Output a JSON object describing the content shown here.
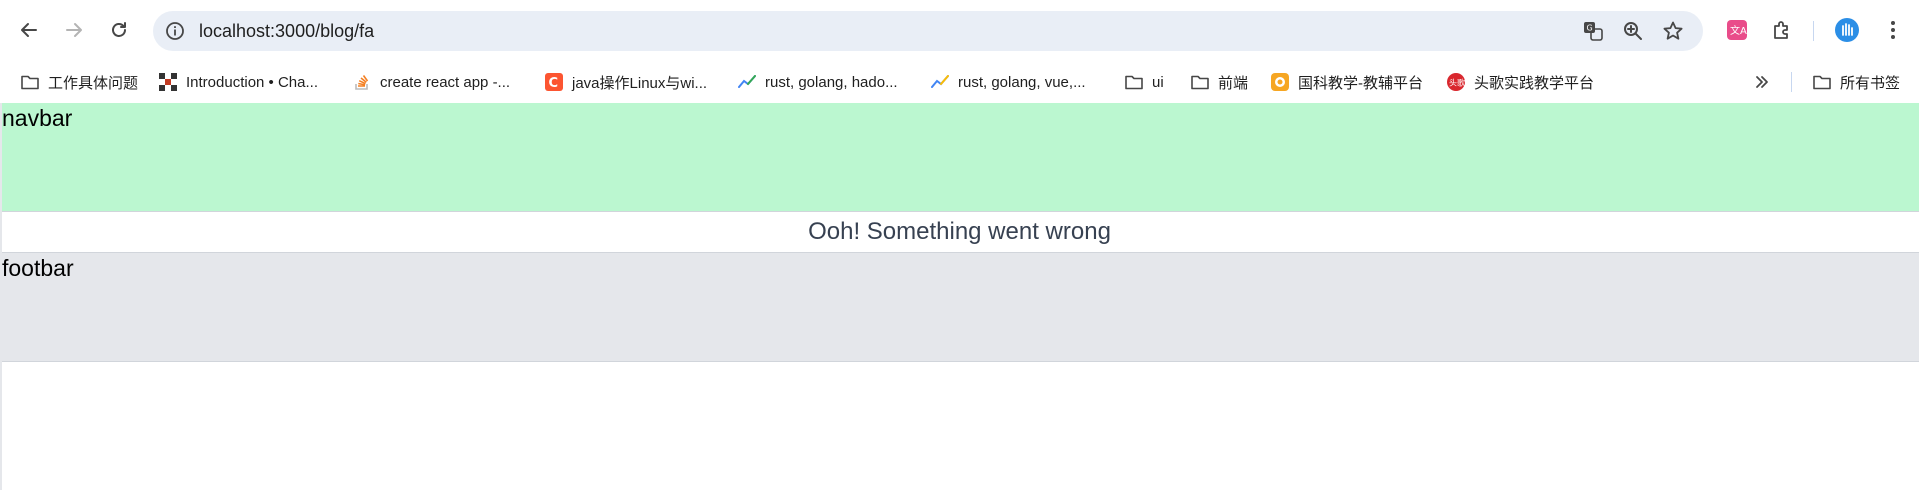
{
  "browser": {
    "url": "localhost:3000/blog/fa",
    "bookmarks": [
      {
        "label": "工作具体问题",
        "icon": "folder-icon"
      },
      {
        "label": "Introduction • Cha...",
        "icon": "site-favicon-icon"
      },
      {
        "label": "create react app -...",
        "icon": "stackoverflow-icon"
      },
      {
        "label": "java操作Linux与wi...",
        "icon": "csdn-icon"
      },
      {
        "label": "rust, golang, hado...",
        "icon": "trend-icon"
      },
      {
        "label": "rust, golang, vue,...",
        "icon": "trend-icon"
      },
      {
        "label": "ui",
        "icon": "folder-icon"
      },
      {
        "label": "前端",
        "icon": "folder-icon"
      },
      {
        "label": "国科教学-教辅平台",
        "icon": "school-icon"
      },
      {
        "label": "头歌实践教学平台",
        "icon": "touge-icon"
      }
    ],
    "all_bookmarks_label": "所有书签"
  },
  "page": {
    "navbar_text": "navbar",
    "error_text": "Ooh! Something went wrong",
    "footbar_text": "footbar"
  },
  "colors": {
    "navbar_bg": "#bbf7d0",
    "footbar_bg": "#e5e7eb",
    "omnibox_bg": "#e9eef6"
  }
}
